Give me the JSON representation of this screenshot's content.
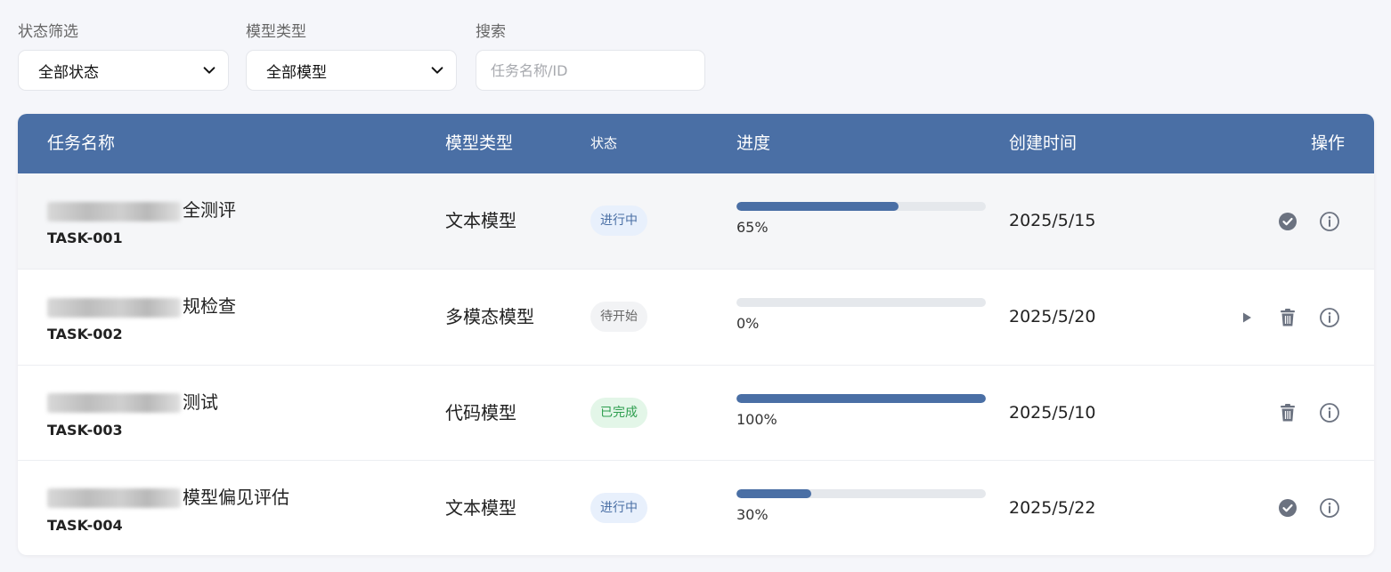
{
  "filters": {
    "status_label": "状态筛选",
    "status_value": "全部状态",
    "model_label": "模型类型",
    "model_value": "全部模型",
    "search_label": "搜索",
    "search_placeholder": "任务名称/ID"
  },
  "table": {
    "headers": {
      "name": "任务名称",
      "model": "模型类型",
      "status": "状态",
      "progress": "进度",
      "created": "创建时间",
      "actions": "操作"
    },
    "rows": [
      {
        "name_visible": "全测评",
        "id": "TASK-001",
        "model": "文本模型",
        "status": "进行中",
        "progress": 65,
        "progress_text": "65%",
        "date": "2025/5/15",
        "actions": [
          "complete-icon",
          "info-icon"
        ]
      },
      {
        "name_visible": "规检查",
        "id": "TASK-002",
        "model": "多模态模型",
        "status": "待开始",
        "progress": 0,
        "progress_text": "0%",
        "date": "2025/5/20",
        "actions": [
          "play-icon",
          "trash-icon",
          "info-icon"
        ]
      },
      {
        "name_visible": "测试",
        "id": "TASK-003",
        "model": "代码模型",
        "status": "已完成",
        "progress": 100,
        "progress_text": "100%",
        "date": "2025/5/10",
        "actions": [
          "trash-icon",
          "info-icon"
        ]
      },
      {
        "name_visible": "模型偏见评估",
        "id": "TASK-004",
        "model": "文本模型",
        "status": "进行中",
        "progress": 30,
        "progress_text": "30%",
        "date": "2025/5/22",
        "actions": [
          "complete-icon",
          "info-icon"
        ]
      }
    ]
  },
  "colors": {
    "header_bg": "#4a6fa5",
    "progress_fill": "#4a6fa5",
    "badge_running_bg": "#e8f0fc",
    "badge_running_text": "#4a6fa5",
    "badge_pending_bg": "#f2f3f5",
    "badge_pending_text": "#666666",
    "badge_done_bg": "#e3f6e8",
    "badge_done_text": "#2e9e4f"
  }
}
